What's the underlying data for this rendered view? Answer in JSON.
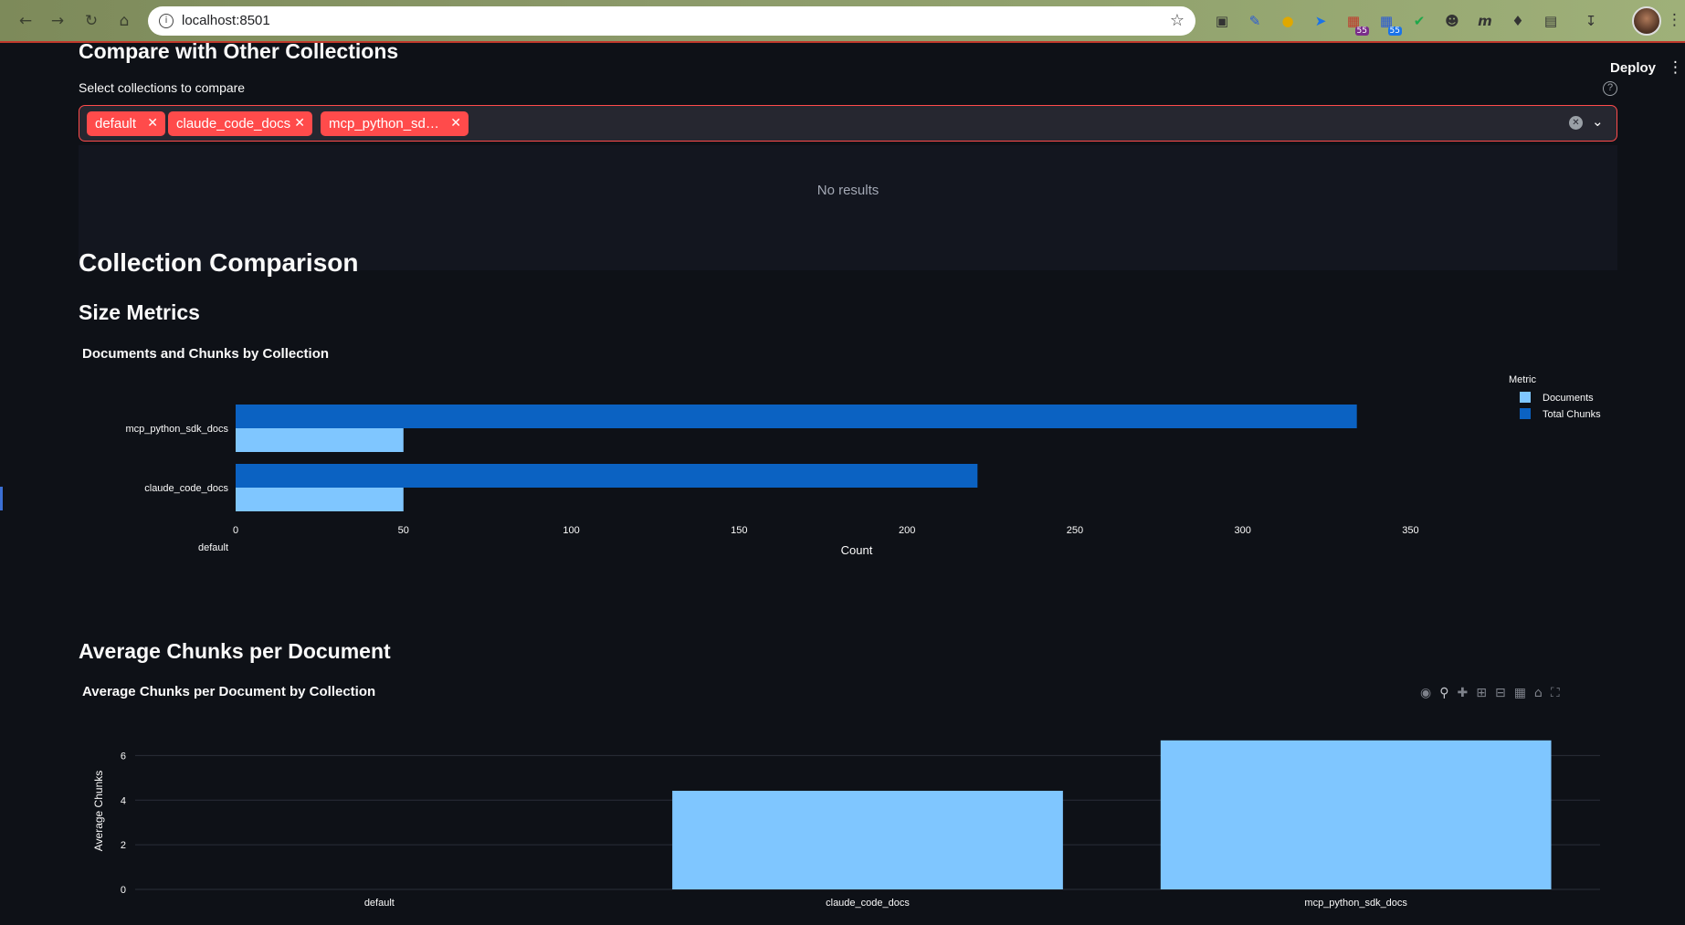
{
  "browser": {
    "url": "localhost:8501",
    "badge_1": "55",
    "badge_2": "55"
  },
  "header": {
    "deploy_label": "Deploy"
  },
  "compare": {
    "heading": "Compare with Other Collections",
    "select_label": "Select collections to compare",
    "chips": [
      "default",
      "claude_code_docs",
      "mcp_python_sd…"
    ],
    "no_results": "No results"
  },
  "comparison": {
    "heading": "Collection Comparison",
    "size_heading": "Size Metrics",
    "avg_heading": "Average Chunks per Document"
  },
  "colors": {
    "documents": "#7fc6ff",
    "total_chunks": "#0b62c2",
    "accent": "#ff4b4b"
  },
  "chart_data": [
    {
      "type": "bar",
      "orientation": "horizontal",
      "title": "Documents and Chunks by Collection",
      "categories": [
        "mcp_python_sdk_docs",
        "claude_code_docs",
        "default"
      ],
      "series": [
        {
          "name": "Documents",
          "values": [
            50,
            50,
            0
          ]
        },
        {
          "name": "Total Chunks",
          "values": [
            334,
            221,
            0
          ]
        }
      ],
      "xlabel": "Count",
      "xlim": [
        0,
        370
      ],
      "xticks": [
        "0",
        "50",
        "100",
        "150",
        "200",
        "250",
        "300",
        "350"
      ],
      "legend_title": "Metric",
      "legend_position": "top-right"
    },
    {
      "type": "bar",
      "title": "Average Chunks per Document by Collection",
      "categories": [
        "default",
        "claude_code_docs",
        "mcp_python_sdk_docs"
      ],
      "values": [
        0,
        4.42,
        6.68
      ],
      "ylabel": "Average Chunks",
      "ylim": [
        0,
        7
      ],
      "yticks": [
        "0",
        "2",
        "4",
        "6"
      ],
      "grid": true
    }
  ]
}
